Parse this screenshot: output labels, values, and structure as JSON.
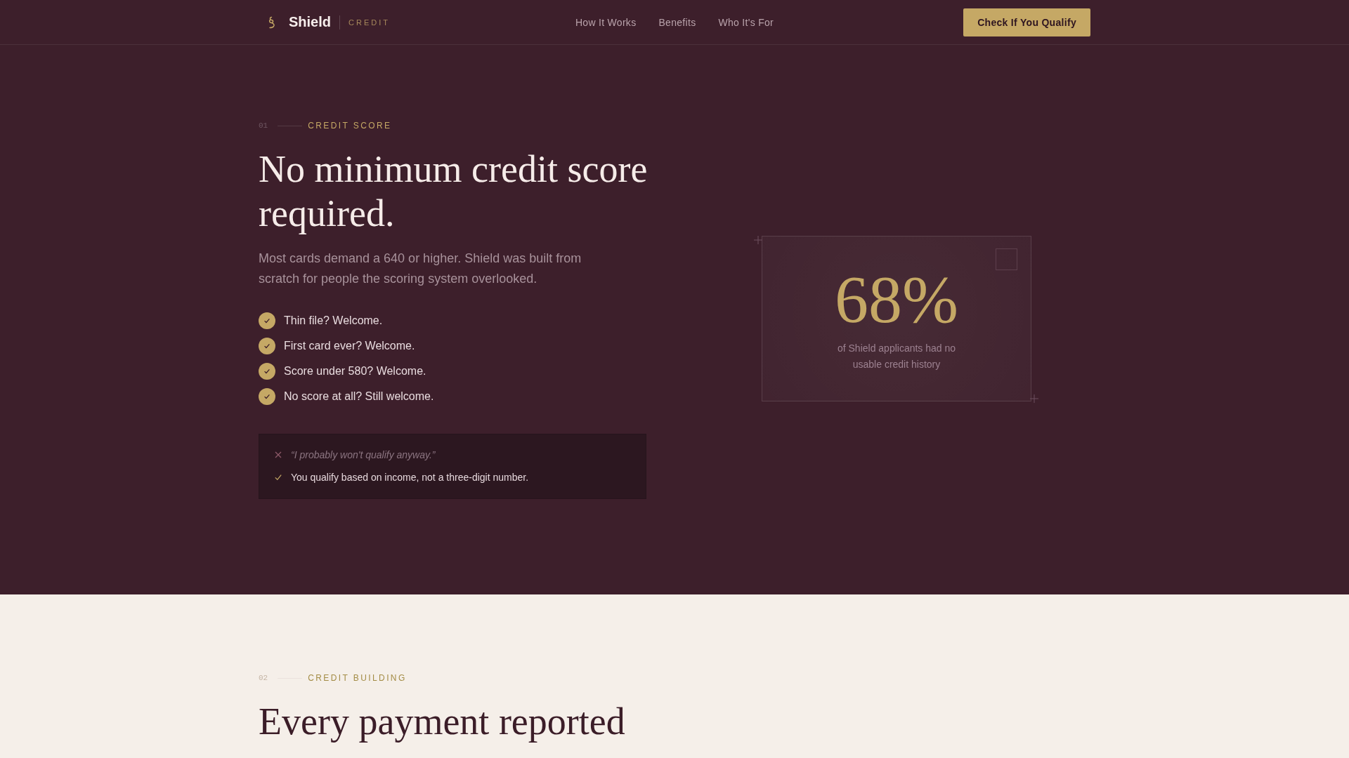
{
  "nav": {
    "brand": "Shield",
    "tagline": "CREDIT",
    "links": [
      "How It Works",
      "Benefits",
      "Who It's For"
    ],
    "cta": "Check If You Qualify"
  },
  "hero": {
    "index": "01",
    "eyebrow": "CREDIT SCORE",
    "heading": "No minimum credit score required.",
    "body": "Most cards demand a 640 or higher. Shield was built from scratch for people the scoring system overlooked.",
    "checklist": [
      "Thin file? Welcome.",
      "First card ever? Welcome.",
      "Score under 580? Welcome.",
      "No score at all? Still welcome."
    ],
    "myth_box": [
      {
        "kind": "myth",
        "text": "“I probably won't qualify anyway.”"
      },
      {
        "kind": "fact",
        "text": "You qualify based on income, not a three-digit number."
      }
    ],
    "stat": {
      "value": "68%",
      "caption": "of Shield applicants had no usable credit history"
    }
  },
  "next_section": {
    "index": "02",
    "eyebrow": "CREDIT BUILDING",
    "heading": "Every payment reported"
  }
}
